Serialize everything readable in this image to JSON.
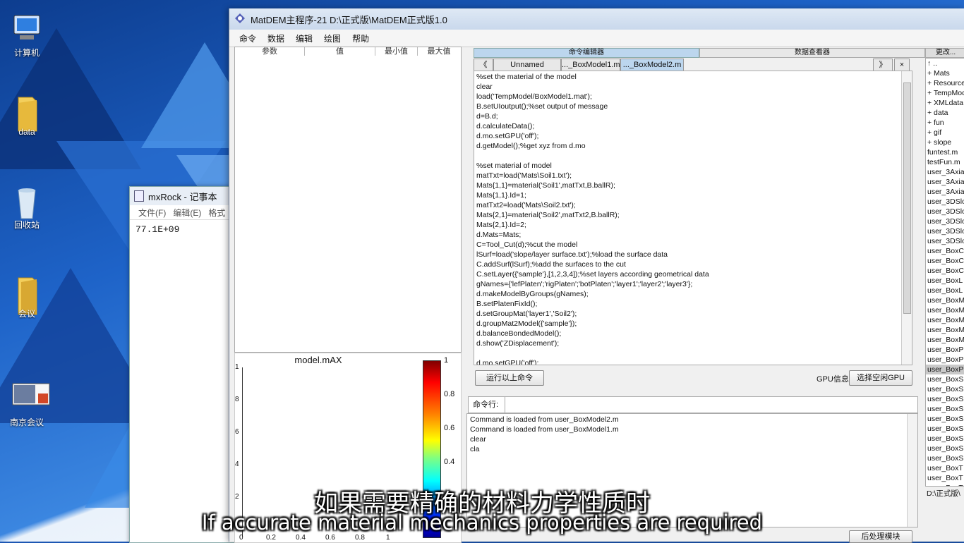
{
  "desktop": {
    "icons": [
      {
        "label": "计算机"
      },
      {
        "label": "data"
      },
      {
        "label": "回收站"
      },
      {
        "label": "会议"
      },
      {
        "label": "南京会议"
      }
    ]
  },
  "notepad": {
    "title": "mxRock - 记事本",
    "menu": [
      "文件(F)",
      "编辑(E)",
      "格式"
    ],
    "content": "77.1E+09"
  },
  "main": {
    "title": "MatDEM主程序-21 D:\\正式版\\MatDEM正式版1.0",
    "menu": [
      "命令",
      "数据",
      "编辑",
      "绘图",
      "帮助"
    ],
    "param_table": {
      "headers": [
        "参数",
        "值",
        "最小值",
        "最大值"
      ]
    },
    "plot": {
      "title": "model.mAX",
      "y_ticks": [
        "1",
        "8",
        "6",
        "4",
        "2"
      ],
      "x_ticks": [
        "0",
        "0.2",
        "0.4",
        "0.6",
        "0.8",
        "1"
      ],
      "colorbar_ticks": [
        "1",
        "0.8",
        "0.6",
        "0.4"
      ]
    },
    "editor_header": {
      "left": "命令编辑器",
      "right": "数据查看器"
    },
    "tabs": [
      "Unnamed",
      "..._BoxModel1.m",
      "..._BoxModel2.m"
    ],
    "tab_nav": {
      "prev": "《",
      "next": "》",
      "close": "×"
    },
    "code_lines": [
      "%set the material of the model",
      "clear",
      "load('TempModel/BoxModel1.mat');",
      "B.setUIoutput();%set output of message",
      "d=B.d;",
      "d.calculateData();",
      "d.mo.setGPU('off');",
      "d.getModel();%get xyz from d.mo",
      "",
      "%set material of model",
      "matTxt=load('Mats\\Soil1.txt');",
      "Mats{1,1}=material('Soil1',matTxt,B.ballR);",
      "Mats{1,1}.Id=1;",
      "matTxt2=load('Mats\\Soil2.txt');",
      "Mats{2,1}=material('Soil2',matTxt2,B.ballR);",
      "Mats{2,1}.Id=2;",
      "d.Mats=Mats;",
      "C=Tool_Cut(d);%cut the model",
      "lSurf=load('slope/layer surface.txt');%load the surface data",
      "C.addSurf(lSurf);%add the surfaces to the cut",
      "C.setLayer({'sample'},[1,2,3,4]);%set layers according geometrical data",
      "gNames={'lefPlaten';'rigPlaten';'botPlaten';'layer1';'layer2';'layer3'};",
      "d.makeModelByGroups(gNames);",
      "B.setPlatenFixId();",
      "d.setGroupMat('layer1','Soil2');",
      "d.groupMat2Model({'sample'});",
      "d.balanceBondedModel();",
      "d.show('ZDisplacement');",
      "",
      "d.mo.setGPU('off');"
    ],
    "run_button": "运行以上命令",
    "gpu_label": "GPU信息",
    "gpu_button": "选择空闲GPU",
    "cmd_label": "命令行:",
    "cmd_output": [
      "Command is loaded from user_BoxModel2.m",
      "Command is loaded from user_BoxModel1.m",
      "clear",
      "cla"
    ],
    "post_button": "后处理模块",
    "file_header": "更改...",
    "files": [
      "↑ ..",
      "+ Mats",
      "+ Resource",
      "+ TempMod",
      "+ XMLdata",
      "+ data",
      "+ fun",
      "+ gif",
      "+ slope",
      "funtest.m",
      "testFun.m",
      "user_3Axia",
      "user_3Axia",
      "user_3Axia",
      "user_3DSlo",
      "user_3DSlo",
      "user_3DSlo",
      "user_3DSlo",
      "user_3DSlo",
      "user_BoxC",
      "user_BoxC",
      "user_BoxC",
      "user_BoxL",
      "user_BoxL",
      "user_BoxM",
      "user_BoxM",
      "user_BoxM",
      "user_BoxM",
      "user_BoxM",
      "user_BoxP",
      "user_BoxP",
      "user_BoxP",
      "user_BoxS",
      "user_BoxS",
      "user_BoxS",
      "user_BoxS",
      "user_BoxS",
      "user_BoxS",
      "user_BoxS",
      "user_BoxS",
      "user_BoxS",
      "user_BoxT",
      "user_BoxT",
      "user_BoxT"
    ],
    "selected_file_index": 31,
    "path_label": "D:\\正式版\\"
  },
  "subtitles": {
    "zh": "如果需要精确的材料力学性质时",
    "en": "If accurate material mechanics properties are required"
  },
  "colors": {
    "accent_tab": "#bcd6ee",
    "selection": "#c9c9c9",
    "desktop_blue": "#1d57b3"
  }
}
